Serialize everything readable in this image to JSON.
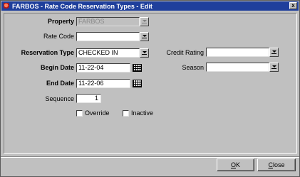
{
  "window": {
    "title": "FARBOS - Rate Code Reservation Types - Edit",
    "close_glyph": "x"
  },
  "form": {
    "property": {
      "label": "Property",
      "value": "FARBOS"
    },
    "rate_code": {
      "label": "Rate Code",
      "value": ""
    },
    "reservation_type": {
      "label": "Reservation Type",
      "value": "CHECKED IN"
    },
    "begin_date": {
      "label": "Begin Date",
      "value": "11-22-04"
    },
    "end_date": {
      "label": "End Date",
      "value": "11-22-06"
    },
    "sequence": {
      "label": "Sequence",
      "value": "1"
    },
    "credit_rating": {
      "label": "Credit Rating",
      "value": ""
    },
    "season": {
      "label": "Season",
      "value": ""
    },
    "override": {
      "label": "Override",
      "checked": false
    },
    "inactive": {
      "label": "Inactive",
      "checked": false
    }
  },
  "buttons": {
    "ok": {
      "mnemonic": "O",
      "rest": "K"
    },
    "close": {
      "mnemonic": "C",
      "rest": "lose"
    }
  }
}
